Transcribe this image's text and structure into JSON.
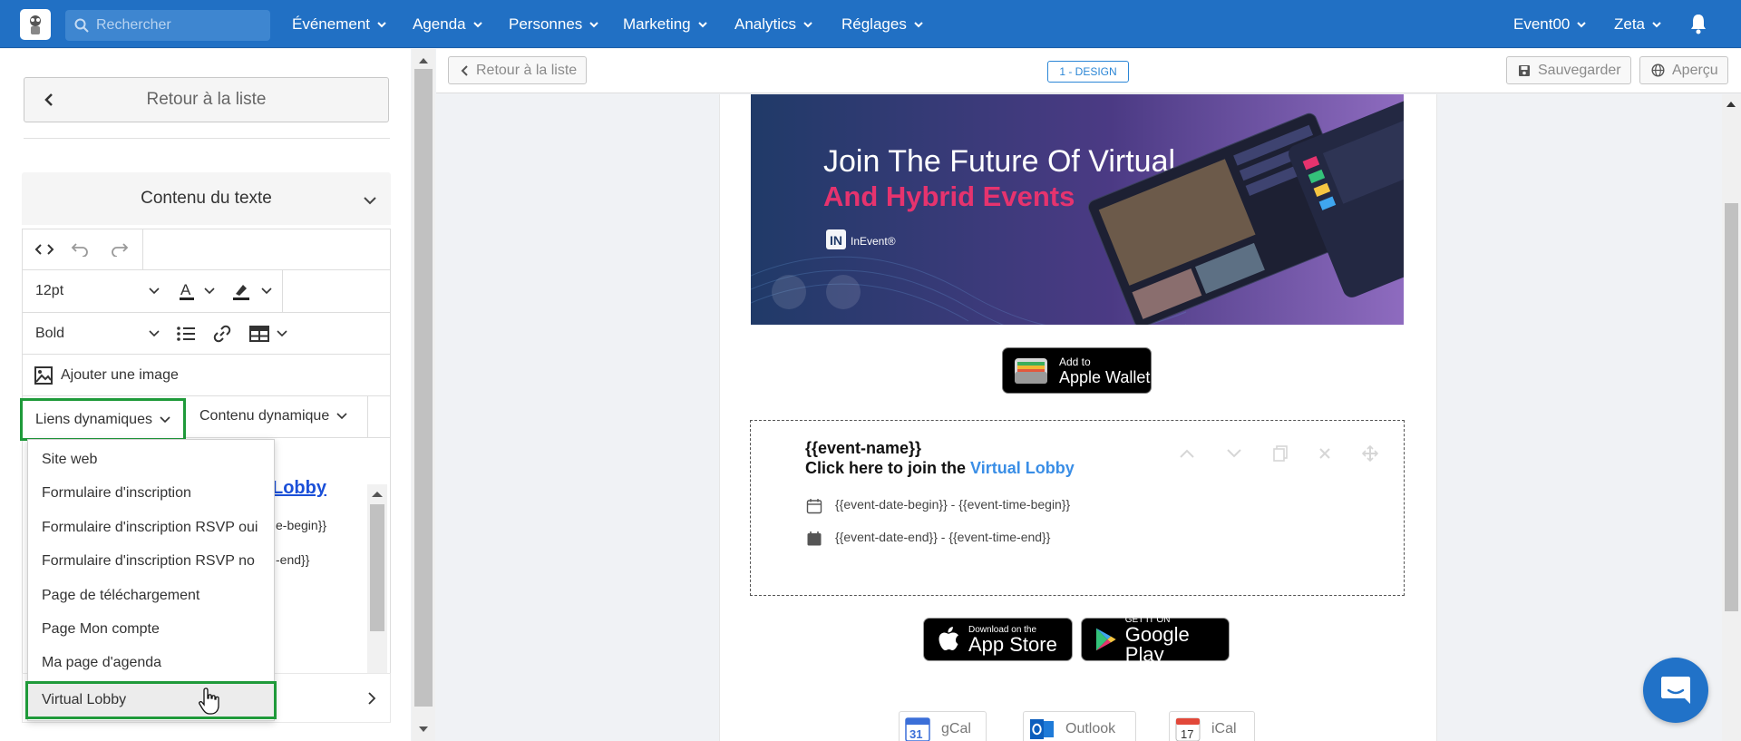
{
  "topbar": {
    "search_placeholder": "Rechercher",
    "nav": [
      {
        "label": "Événement"
      },
      {
        "label": "Agenda"
      },
      {
        "label": "Personnes"
      },
      {
        "label": "Marketing"
      },
      {
        "label": "Analytics"
      },
      {
        "label": "Réglages"
      }
    ],
    "event": "Event00",
    "user": "Zeta"
  },
  "sidebar": {
    "back_label": "Retour à la liste",
    "section_title": "Contenu du texte",
    "font_size": "12pt",
    "font_weight": "Bold",
    "add_image": "Ajouter une image",
    "dynamic_links": "Liens dynamiques",
    "dynamic_content": "Contenu dynamique",
    "bg_link_fragment": "Lobby",
    "bg_date_begin_fragment": "e-begin}}",
    "bg_date_end_fragment": "-end}}",
    "dropdown_items": [
      "Site web",
      "Formulaire d'inscription",
      "Formulaire d'inscription RSVP oui",
      "Formulaire d'inscription RSVP no",
      "Page de téléchargement",
      "Page Mon compte",
      "Ma page d'agenda",
      "Virtual Lobby"
    ]
  },
  "toolbar": {
    "back_label": "Retour à la liste",
    "design_badge": "1 - DESIGN",
    "save_label": "Sauvegarder",
    "preview_label": "Aperçu"
  },
  "email": {
    "banner_line1": "Join The Future Of Virtual",
    "banner_line2": "And Hybrid Events",
    "banner_brand": "InEvent®",
    "wallet_small": "Add to",
    "wallet_big": "Apple Wallet",
    "event_name": "{{event-name}}",
    "click_prefix": "Click here to join the ",
    "click_link": "Virtual Lobby",
    "date_begin": "{{event-date-begin}} - {{event-time-begin}}",
    "date_end": "{{event-date-end}} - {{event-time-end}}",
    "appstore_small": "Download on the",
    "appstore_big": "App Store",
    "gplay_small": "GET IT ON",
    "gplay_big": "Google Play",
    "gcal_label": "gCal",
    "gcal_day": "31",
    "outlook_label": "Outlook",
    "ical_label": "iCal",
    "ical_day": "17"
  },
  "colors": {
    "topbar": "#2170c4",
    "highlight": "#1f9a3a",
    "link": "#3a8ee6"
  }
}
